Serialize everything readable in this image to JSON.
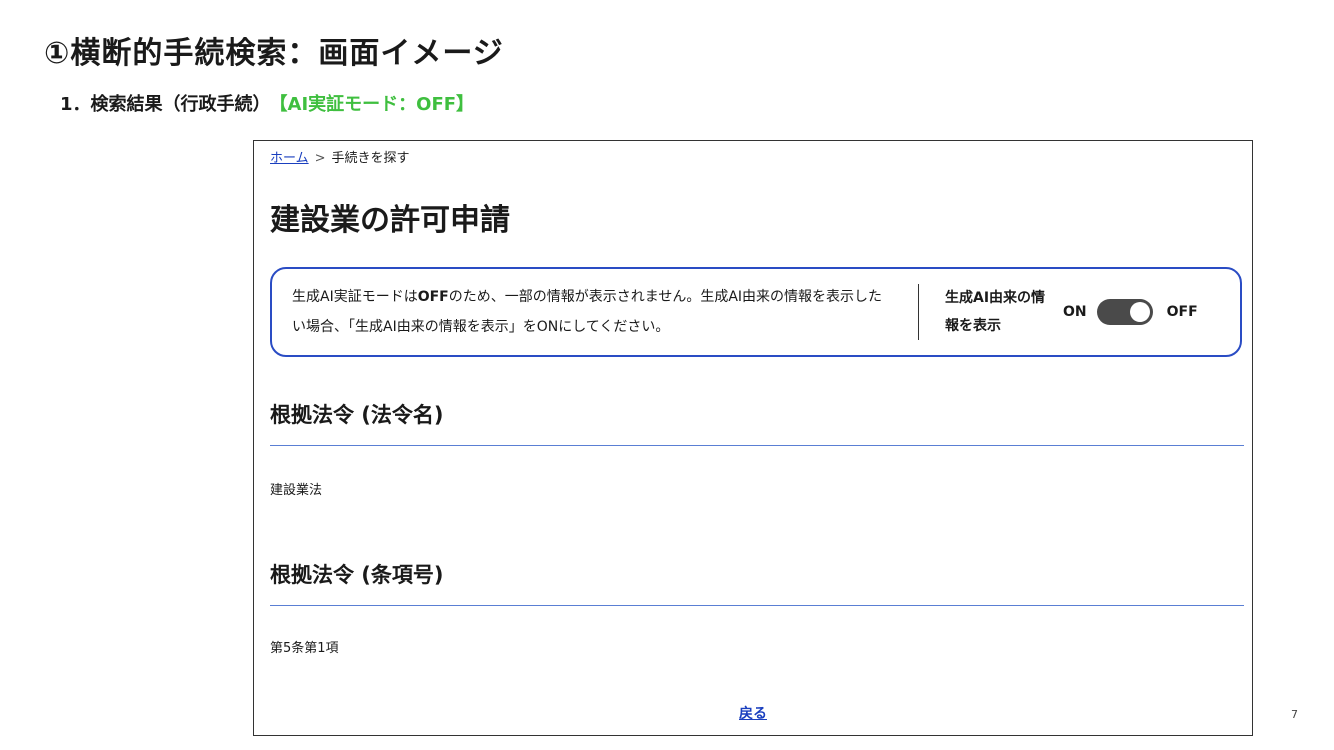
{
  "slide": {
    "title": "①横断的手続検索：画面イメージ",
    "subtitle": "1．検索結果（行政手続）",
    "mode_tag": "【AI実証モード：OFF】",
    "page_number": "7"
  },
  "breadcrumb": {
    "home": "ホーム",
    "separator": ">",
    "current": "手続きを探す"
  },
  "page": {
    "title": "建設業の許可申請"
  },
  "notice": {
    "text_before": "生成AI実証モードは",
    "text_bold": "OFF",
    "text_after": "のため、一部の情報が表示されません。生成AI由来の情報を表示したい場合、「生成AI由来の情報を表示」をONにしてください。",
    "toggle_label": "生成AI由来の情報を表示",
    "on_label": "ON",
    "off_label": "OFF",
    "toggle_state": "OFF"
  },
  "sections": [
    {
      "heading": "根拠法令 (法令名)",
      "value": "建設業法"
    },
    {
      "heading": "根拠法令 (条項号)",
      "value": "第5条第1項"
    }
  ],
  "back": {
    "label": "戻る"
  }
}
